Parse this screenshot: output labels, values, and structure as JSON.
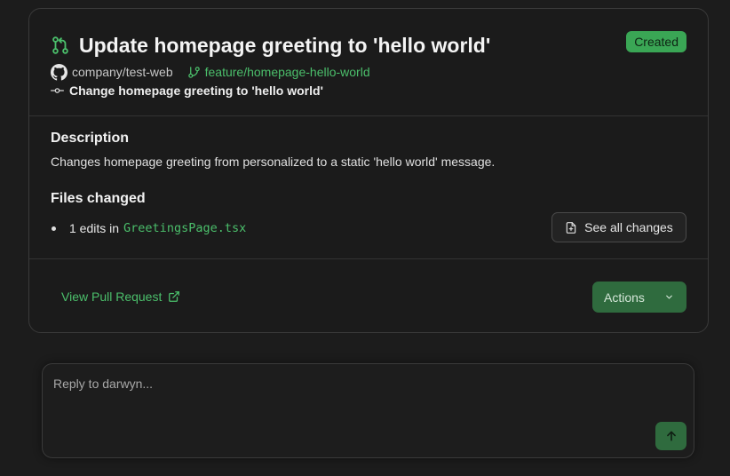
{
  "pr": {
    "title": "Update homepage greeting to 'hello world'",
    "status": "Created",
    "repo": "company/test-web",
    "branch": "feature/homepage-hello-world",
    "commit_message": "Change homepage greeting to 'hello world'"
  },
  "description": {
    "heading": "Description",
    "text": "Changes homepage greeting from personalized to a static 'hello world' message."
  },
  "files": {
    "heading": "Files changed",
    "items": [
      {
        "prefix": "1 edits in",
        "filename": "GreetingsPage.tsx"
      }
    ],
    "see_all_label": "See all changes"
  },
  "footer": {
    "view_pr_label": "View Pull Request",
    "actions_label": "Actions"
  },
  "reply": {
    "placeholder": "Reply to darwyn..."
  },
  "icons": {
    "pr": "git-pull-request-icon",
    "repo": "github-icon",
    "branch": "git-branch-icon",
    "commit": "git-commit-icon",
    "file": "file-diff-icon",
    "external": "external-link-icon",
    "chevron": "chevron-down-icon",
    "send": "arrow-up-icon"
  },
  "colors": {
    "accent": "#4bbf6b",
    "badge": "#3aa655",
    "button": "#2f6b3e",
    "background": "#1c1c1c"
  }
}
